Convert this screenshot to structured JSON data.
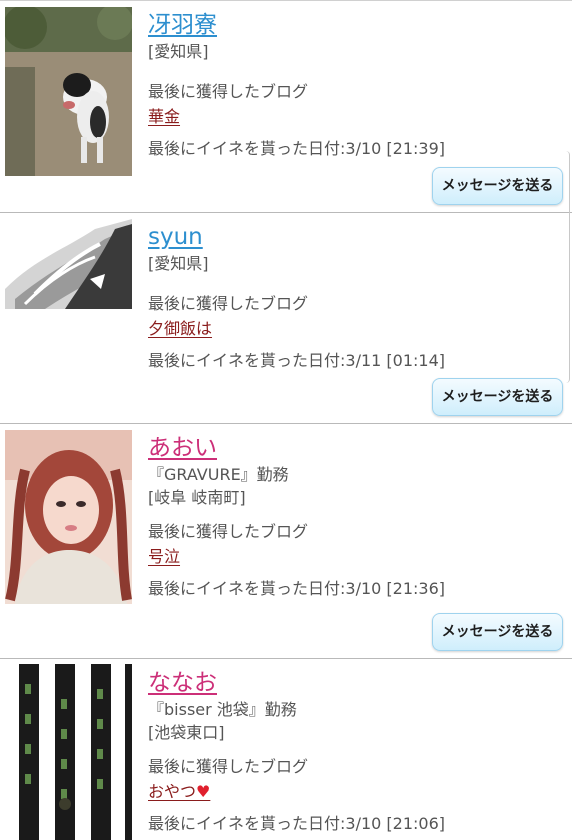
{
  "common": {
    "blog_label": "最後に獲得したブログ",
    "like_date_prefix": "最後にイイネを貰った日付:",
    "message_button": "メッセージを送る"
  },
  "users": [
    {
      "name": "冴羽寮",
      "workplace": "",
      "location": "[愛知県]",
      "blog_title": "華金",
      "like_date": "3/10 [21:39]"
    },
    {
      "name": "syun",
      "workplace": "",
      "location": "[愛知県]",
      "blog_title": "夕御飯は",
      "like_date": "3/11 [01:14]"
    },
    {
      "name": "あおい",
      "workplace": "『GRAVURE』勤務",
      "location": "[岐阜 岐南町]",
      "blog_title": "号泣",
      "like_date": "3/10 [21:36]"
    },
    {
      "name": "ななお",
      "workplace": "『bisser 池袋』勤務",
      "location": "[池袋東口]",
      "blog_title": "おやつ",
      "blog_heart": "♥",
      "like_date": "3/10 [21:06]"
    }
  ]
}
